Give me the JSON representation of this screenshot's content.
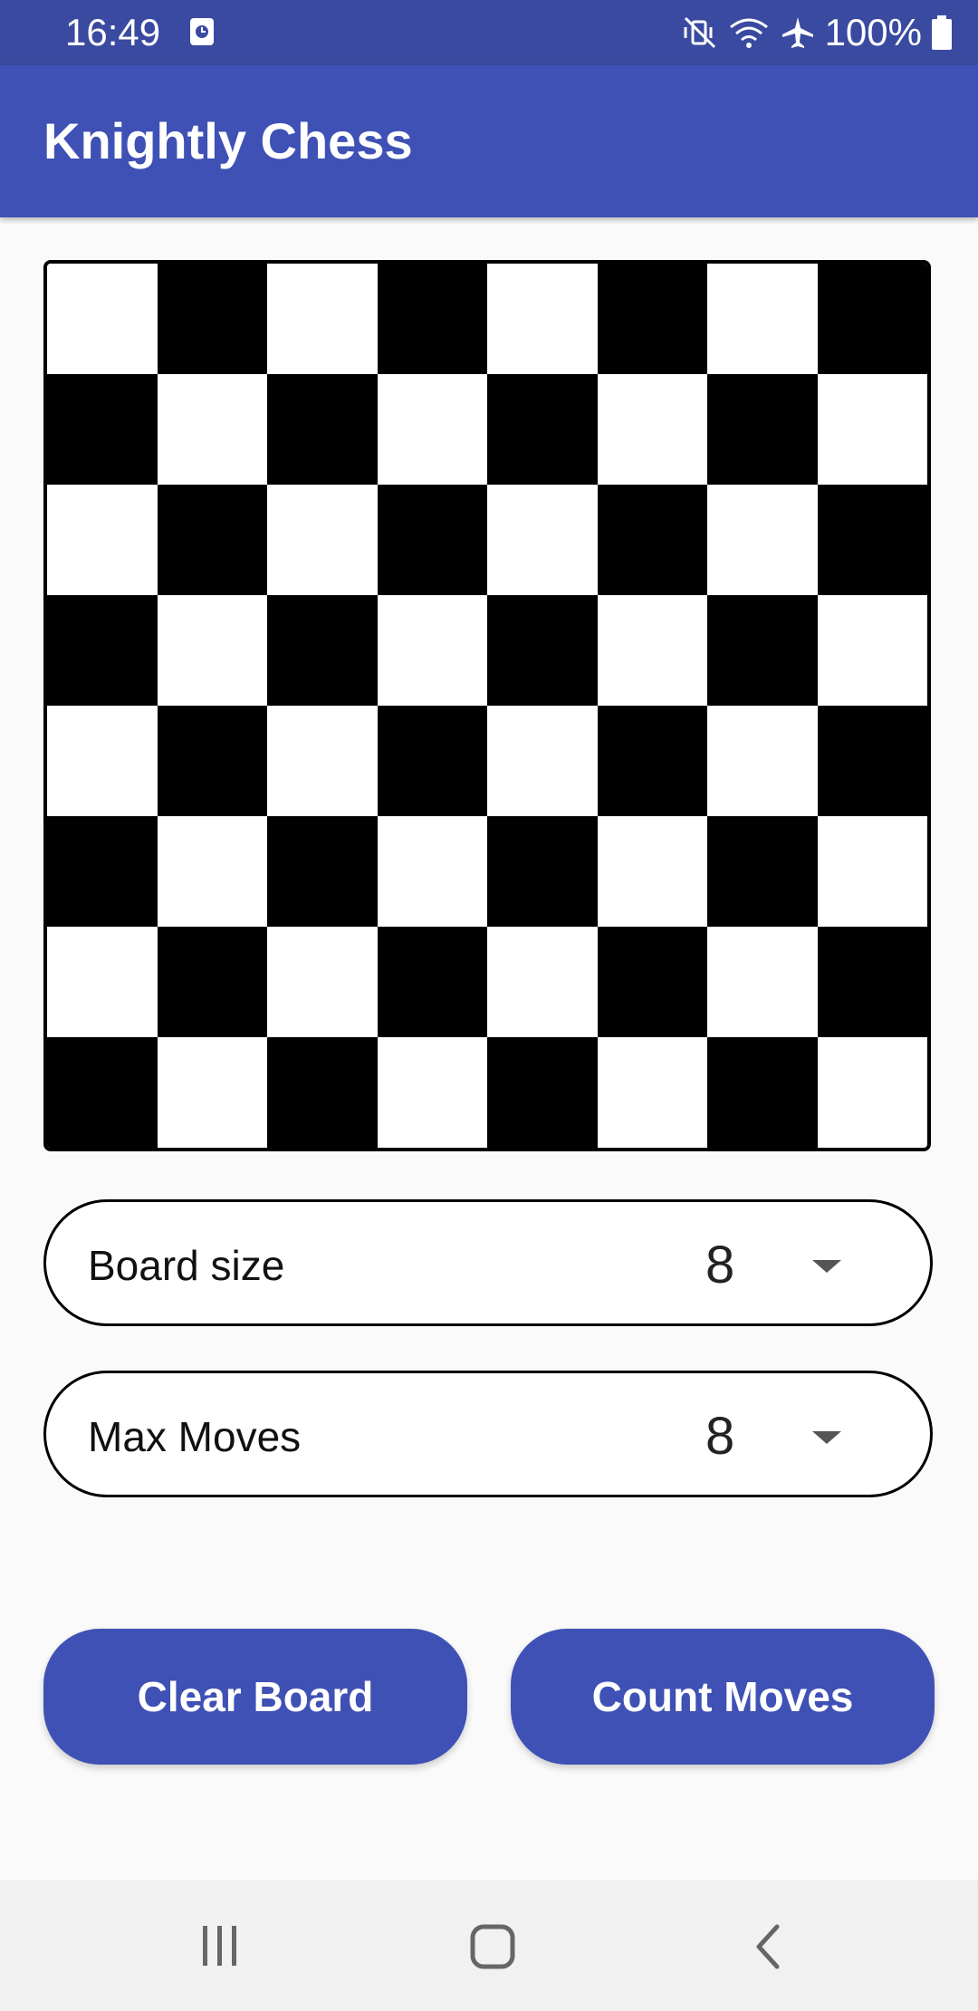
{
  "status_bar": {
    "time": "16:49",
    "battery": "100%",
    "icons": [
      "clock-badge-icon",
      "mute-vibrate-icon",
      "wifi-icon",
      "airplane-icon",
      "battery-icon"
    ]
  },
  "app": {
    "title": "Knightly Chess",
    "colors": {
      "primary": "#3f51b5",
      "status": "#3a4aa0"
    }
  },
  "board": {
    "size": 8,
    "colors": {
      "dark": "#000000",
      "light": "#ffffff"
    }
  },
  "board_size_spinner": {
    "label": "Board size",
    "value": "8"
  },
  "max_moves_spinner": {
    "label": "Max Moves",
    "value": "8"
  },
  "buttons": {
    "clear": "Clear Board",
    "count": "Count Moves"
  },
  "nav": {
    "icons": [
      "recent-apps-icon",
      "home-icon",
      "back-icon"
    ]
  }
}
